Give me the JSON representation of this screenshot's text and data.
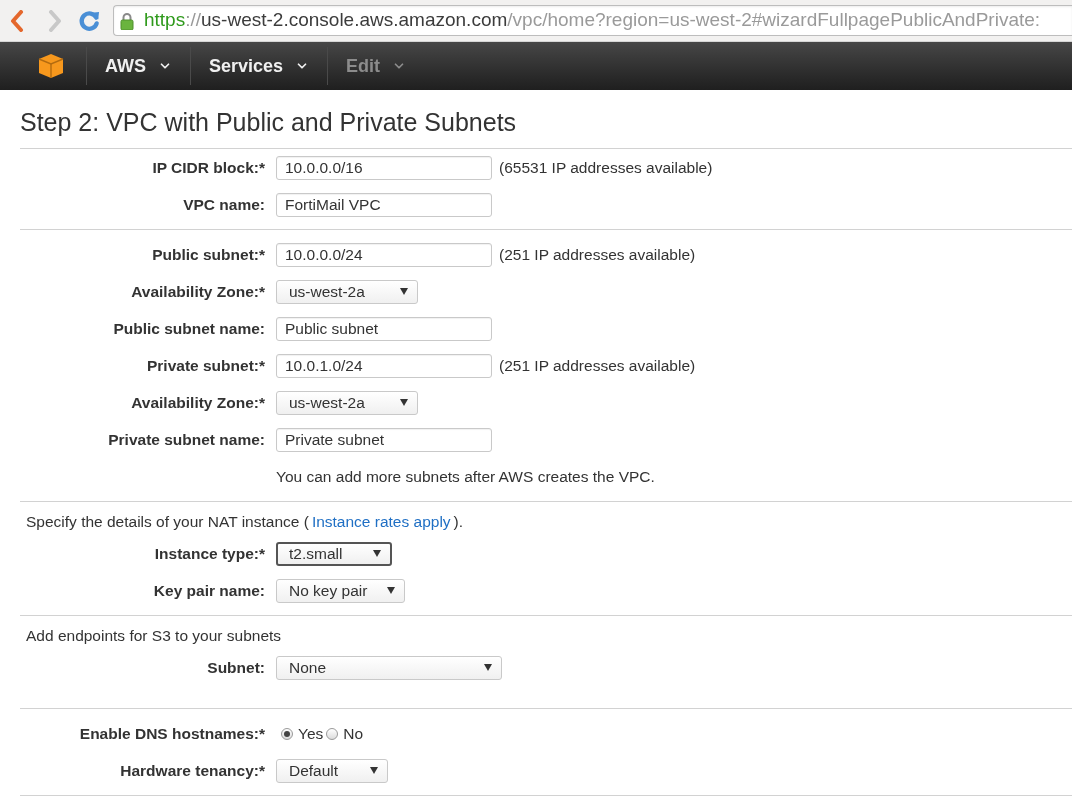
{
  "browser": {
    "nav_buttons": [
      {
        "kind": "back",
        "disabled": false
      },
      {
        "kind": "forward",
        "disabled": true
      },
      {
        "kind": "reload",
        "disabled": false
      }
    ],
    "address": {
      "secure": true,
      "scheme": "https",
      "separator": "://",
      "host": "us-west-2.console.aws.amazon.com",
      "path": "/vpc/home?region=us-west-2#wizardFullpagePublicAndPrivate:"
    }
  },
  "console_nav": {
    "items": [
      {
        "label": "AWS",
        "disabled": false
      },
      {
        "label": "Services",
        "disabled": false
      },
      {
        "label": "Edit",
        "disabled": true
      }
    ]
  },
  "page_title": "Step 2: VPC with Public and Private Subnets",
  "sections": [
    {
      "rows": [
        {
          "kind": "text",
          "label": "IP CIDR block:*",
          "value": "10.0.0.0/16",
          "focused": false,
          "hint": "(65531 IP addresses available)"
        },
        {
          "kind": "text",
          "label": "VPC name:",
          "value": "FortiMail VPC",
          "focused": false
        }
      ]
    },
    {
      "rows": [
        {
          "kind": "text",
          "label": "Public subnet:*",
          "value": "10.0.0.0/24",
          "focused": false,
          "hint": "(251 IP addresses available)"
        },
        {
          "kind": "select",
          "label": "Availability Zone:*",
          "value": "us-west-2a",
          "focused": false
        },
        {
          "kind": "text",
          "label": "Public subnet name:",
          "value": "Public subnet",
          "focused": false
        },
        {
          "kind": "text",
          "label": "Private subnet:*",
          "value": "10.0.1.0/24",
          "focused": false,
          "hint": "(251 IP addresses available)"
        },
        {
          "kind": "select",
          "label": "Availability Zone:*",
          "value": "us-west-2a",
          "focused": false
        },
        {
          "kind": "text",
          "label": "Private subnet name:",
          "value": "Private subnet",
          "focused": false
        },
        {
          "kind": "note",
          "text": "You can add more subnets after AWS creates the VPC."
        }
      ]
    },
    {
      "intro": {
        "text": "Specify the details of your NAT instance (",
        "link": "Instance rates apply",
        "text_after": ")."
      },
      "rows": [
        {
          "kind": "select",
          "label": "Instance type:*",
          "value": "t2.small",
          "focused": true
        },
        {
          "kind": "select",
          "label": "Key pair name:",
          "value": "No key pair",
          "focused": false
        }
      ]
    },
    {
      "intro": {
        "text": "Add endpoints for S3 to your subnets"
      },
      "rows": [
        {
          "kind": "select",
          "label": "Subnet:",
          "value": "None",
          "focused": false
        }
      ]
    },
    {
      "rows": [
        {
          "kind": "radio",
          "label": "Enable DNS hostnames:*",
          "options": [
            {
              "label": "Yes",
              "selected": true
            },
            {
              "label": "No",
              "selected": false
            }
          ]
        },
        {
          "kind": "select",
          "label": "Hardware tenancy:*",
          "value": "Default",
          "focused": false
        }
      ]
    }
  ]
}
